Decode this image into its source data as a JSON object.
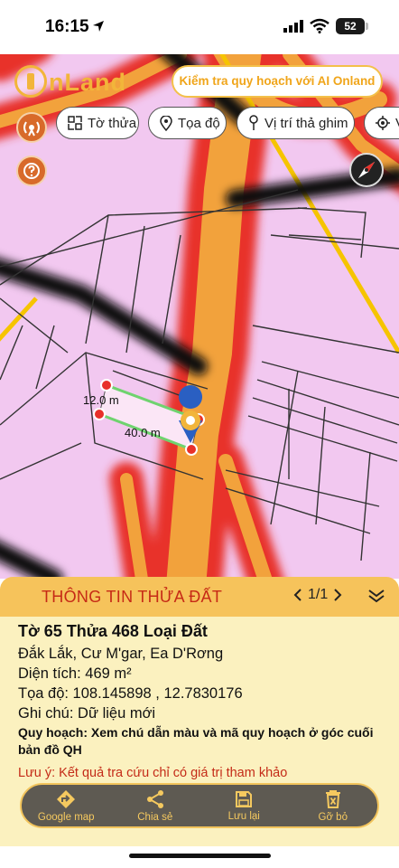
{
  "status_bar": {
    "time": "16:15",
    "battery": "52"
  },
  "map": {
    "logo_text": "nLand",
    "ai_search_placeholder": "Kiểm tra quy hoạch với AI Onland",
    "chips": [
      {
        "label": "Tờ thửa",
        "icon": "parcel-icon"
      },
      {
        "label": "Tọa độ",
        "icon": "location-pin-icon"
      },
      {
        "label": "Vị trí thả ghim",
        "icon": "drop-pin-icon"
      },
      {
        "label": "V",
        "icon": "gps-target-icon"
      }
    ],
    "measurements": {
      "width": "12.0 m",
      "length": "40.0 m"
    }
  },
  "panel": {
    "title": "THÔNG TIN THỬA ĐẤT",
    "pager": "1/1",
    "heading": "Tờ 65 Thửa 468 Loại Đất",
    "location": "Đắk Lắk, Cư M'gar, Ea D'Rơng",
    "area": "Diện tích: 469 m²",
    "coords": "Tọa độ: 108.145898 , 12.7830176",
    "note": "Ghi chú: Dữ liệu mới",
    "planning": "Quy hoạch: Xem chú dẫn màu và mã quy hoạch ở góc cuối bản đồ QH",
    "disclaimer": "Lưu ý: Kết quả tra cứu chỉ có giá trị tham khảo"
  },
  "actions": [
    {
      "label": "Google map",
      "icon": "directions-icon"
    },
    {
      "label": "Chia sẻ",
      "icon": "share-icon"
    },
    {
      "label": "Lưu lại",
      "icon": "save-icon"
    },
    {
      "label": "Gỡ bỏ",
      "icon": "delete-icon"
    }
  ],
  "colors": {
    "accent": "#f6c35b",
    "zone_pink": "#f2c8f0",
    "road_orange": "#f2a23c",
    "alert_red": "#c62a16"
  }
}
